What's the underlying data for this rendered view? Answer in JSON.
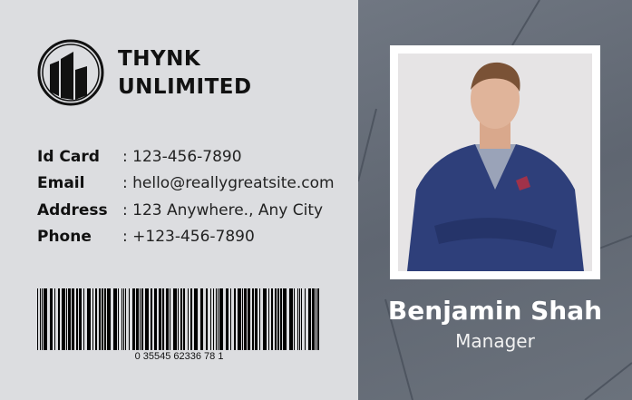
{
  "company": {
    "line1": "THYNK",
    "line2": "UNLIMITED"
  },
  "fields": [
    {
      "label": "Id Card",
      "value": ": 123-456-7890"
    },
    {
      "label": "Email",
      "value": ": hello@reallygreatsite.com"
    },
    {
      "label": "Address",
      "value": ": 123 Anywhere., Any City"
    },
    {
      "label": "Phone",
      "value": ": +123-456-7890"
    }
  ],
  "barcode": {
    "number": "0 35545 62336 78 1"
  },
  "person": {
    "name": "Benjamin Shah",
    "role": "Manager"
  },
  "colors": {
    "panel": "#666d78",
    "card": "#dcdde0",
    "suit": "#2e3f7a"
  }
}
